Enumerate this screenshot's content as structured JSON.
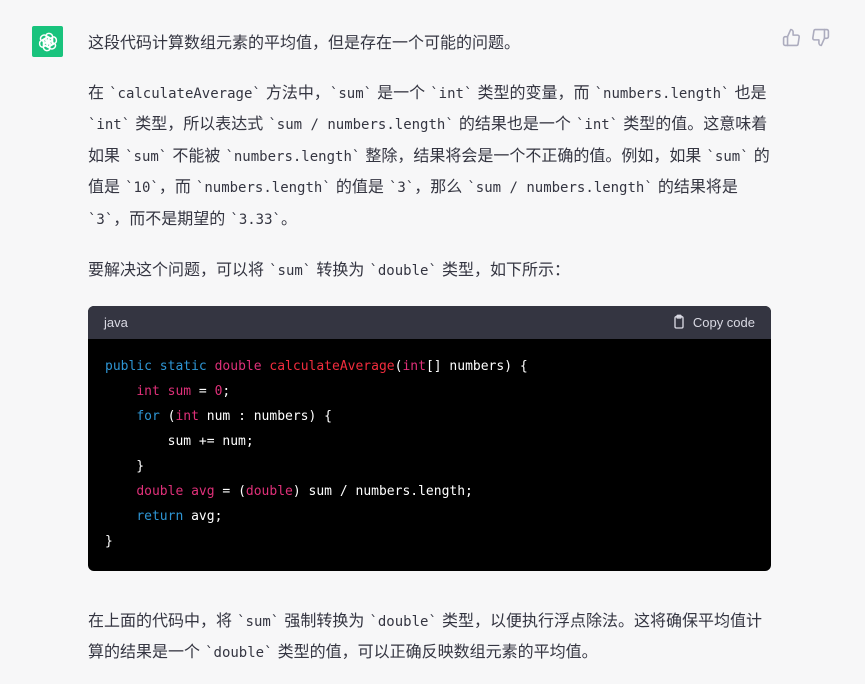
{
  "message": {
    "intro": "这段代码计算数组元素的平均值，但是存在一个可能的问题。",
    "para1": "在 `calculateAverage` 方法中，`sum` 是一个 `int` 类型的变量，而 `numbers.length` 也是 `int` 类型，所以表达式 `sum / numbers.length` 的结果也是一个 `int` 类型的值。这意味着如果 `sum` 不能被 `numbers.length` 整除，结果将会是一个不正确的值。例如，如果 `sum` 的值是 `10`，而 `numbers.length` 的值是 `3`，那么 `sum / numbers.length` 的结果将是 `3`，而不是期望的 `3.33`。",
    "para2": "要解决这个问题，可以将 `sum` 转换为 `double` 类型，如下所示：",
    "para3": "在上面的代码中，将 `sum` 强制转换为 `double` 类型，以便执行浮点除法。这将确保平均值计算的结果是一个 `double` 类型的值，可以正确反映数组元素的平均值。"
  },
  "code_block": {
    "language": "java",
    "copy_label": "Copy code",
    "lines": [
      [
        [
          "kw",
          "public"
        ],
        [
          "t",
          " "
        ],
        [
          "kw",
          "static"
        ],
        [
          "t",
          " "
        ],
        [
          "ty",
          "double"
        ],
        [
          "t",
          " "
        ],
        [
          "fn",
          "calculateAverage"
        ],
        [
          "t",
          "("
        ],
        [
          "ty",
          "int"
        ],
        [
          "t",
          "[] numbers) {"
        ]
      ],
      [
        [
          "t",
          "    "
        ],
        [
          "ty",
          "int"
        ],
        [
          "t",
          " "
        ],
        [
          "ty",
          "sum"
        ],
        [
          "t",
          " = "
        ],
        [
          "nu",
          "0"
        ],
        [
          "t",
          ";"
        ]
      ],
      [
        [
          "t",
          "    "
        ],
        [
          "kw",
          "for"
        ],
        [
          "t",
          " ("
        ],
        [
          "ty",
          "int"
        ],
        [
          "t",
          " num : numbers) {"
        ]
      ],
      [
        [
          "t",
          "        sum += num;"
        ]
      ],
      [
        [
          "t",
          "    }"
        ]
      ],
      [
        [
          "t",
          "    "
        ],
        [
          "ty",
          "double"
        ],
        [
          "t",
          " "
        ],
        [
          "ty",
          "avg"
        ],
        [
          "t",
          " = ("
        ],
        [
          "ty",
          "double"
        ],
        [
          "t",
          ") sum / numbers.length;"
        ]
      ],
      [
        [
          "t",
          "    "
        ],
        [
          "kw",
          "return"
        ],
        [
          "t",
          " avg;"
        ]
      ],
      [
        [
          "t",
          "}"
        ]
      ]
    ]
  },
  "icons": {
    "avatar": "openai-logo-icon",
    "like": "thumbs-up-icon",
    "dislike": "thumbs-down-icon",
    "copy": "clipboard-icon"
  },
  "colors": {
    "avatar_bg": "#19c37d",
    "code_bg": "#000000",
    "code_header_bg": "#343541",
    "keyword": "#2e95d3",
    "type": "#df3079",
    "function": "#f22c3d"
  }
}
